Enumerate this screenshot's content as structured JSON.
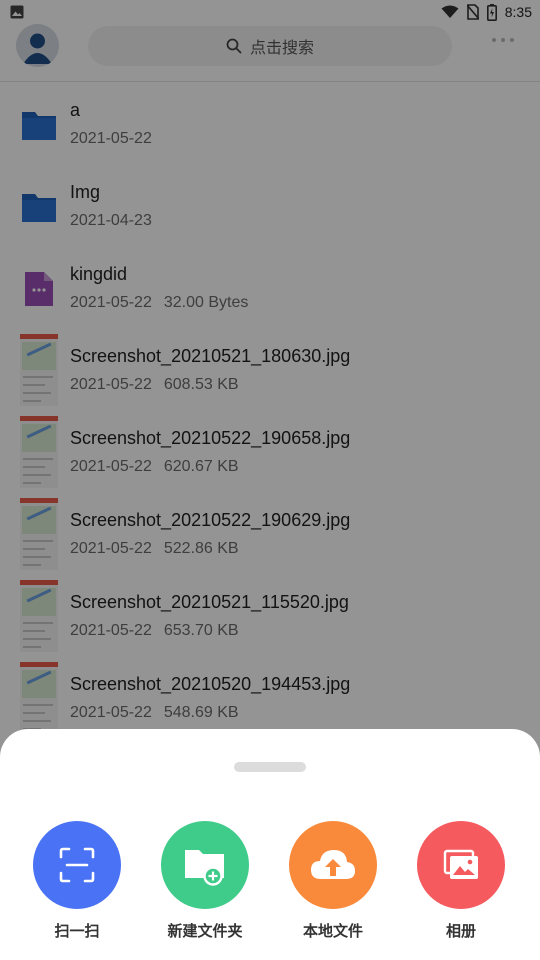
{
  "status_bar": {
    "time": "8:35"
  },
  "header": {
    "search_placeholder": "点击搜索"
  },
  "files": [
    {
      "type": "folder",
      "name": "a",
      "date": "2021-05-22",
      "size": ""
    },
    {
      "type": "folder",
      "name": "Img",
      "date": "2021-04-23",
      "size": ""
    },
    {
      "type": "file",
      "name": "kingdid",
      "date": "2021-05-22",
      "size": "32.00 Bytes"
    },
    {
      "type": "image",
      "name": "Screenshot_20210521_180630.jpg",
      "date": "2021-05-22",
      "size": "608.53 KB"
    },
    {
      "type": "image",
      "name": "Screenshot_20210522_190658.jpg",
      "date": "2021-05-22",
      "size": "620.67 KB"
    },
    {
      "type": "image",
      "name": "Screenshot_20210522_190629.jpg",
      "date": "2021-05-22",
      "size": "522.86 KB"
    },
    {
      "type": "image",
      "name": "Screenshot_20210521_115520.jpg",
      "date": "2021-05-22",
      "size": "653.70 KB"
    },
    {
      "type": "image",
      "name": "Screenshot_20210520_194453.jpg",
      "date": "2021-05-22",
      "size": "548.69 KB"
    }
  ],
  "sheet": {
    "actions": [
      {
        "label": "扫一扫",
        "color": "#4a72f5",
        "icon": "scan-icon"
      },
      {
        "label": "新建文件夹",
        "color": "#3fcb8a",
        "icon": "new-folder-icon"
      },
      {
        "label": "本地文件",
        "color": "#f98a3c",
        "icon": "upload-cloud-icon"
      },
      {
        "label": "相册",
        "color": "#f45a5e",
        "icon": "album-icon"
      }
    ]
  }
}
